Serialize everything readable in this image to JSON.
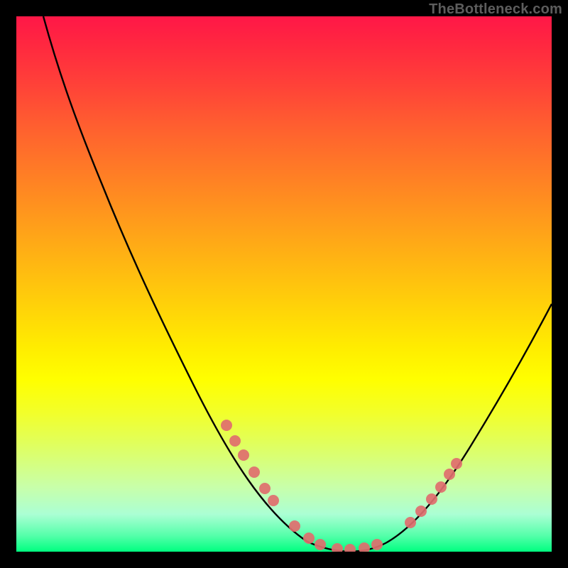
{
  "watermark": "TheBottleneck.com",
  "chart_data": {
    "type": "line",
    "title": "",
    "xlabel": "",
    "ylabel": "",
    "xlim": [
      0,
      100
    ],
    "ylim": [
      0,
      100
    ],
    "grid": false,
    "series": [
      {
        "name": "curve",
        "color": "#000000",
        "x": [
          5,
          10,
          15,
          20,
          25,
          30,
          35,
          40,
          45,
          50,
          55,
          60,
          65,
          70,
          75,
          80,
          85,
          90,
          95,
          100
        ],
        "y": [
          100,
          94,
          85,
          75,
          64,
          53,
          42,
          31,
          21,
          12,
          5,
          1,
          0,
          1,
          6,
          13,
          22,
          32,
          42,
          52
        ]
      }
    ],
    "markers": {
      "name": "highlight-points",
      "color": "#e07070",
      "radius": 8,
      "x": [
        40,
        42,
        44,
        46,
        50,
        55,
        58,
        60,
        63,
        66,
        68,
        70,
        73,
        75,
        77,
        79,
        81
      ],
      "y": [
        31,
        28,
        25,
        22,
        12,
        5,
        2,
        1,
        0,
        0,
        0.5,
        1,
        3,
        6,
        9,
        12,
        15
      ]
    },
    "background_gradient": {
      "direction": "vertical",
      "stops": [
        {
          "pos": 0.0,
          "color": "#ff1747"
        },
        {
          "pos": 0.5,
          "color": "#ffd000"
        },
        {
          "pos": 0.7,
          "color": "#ffff00"
        },
        {
          "pos": 1.0,
          "color": "#00ff80"
        }
      ]
    }
  }
}
